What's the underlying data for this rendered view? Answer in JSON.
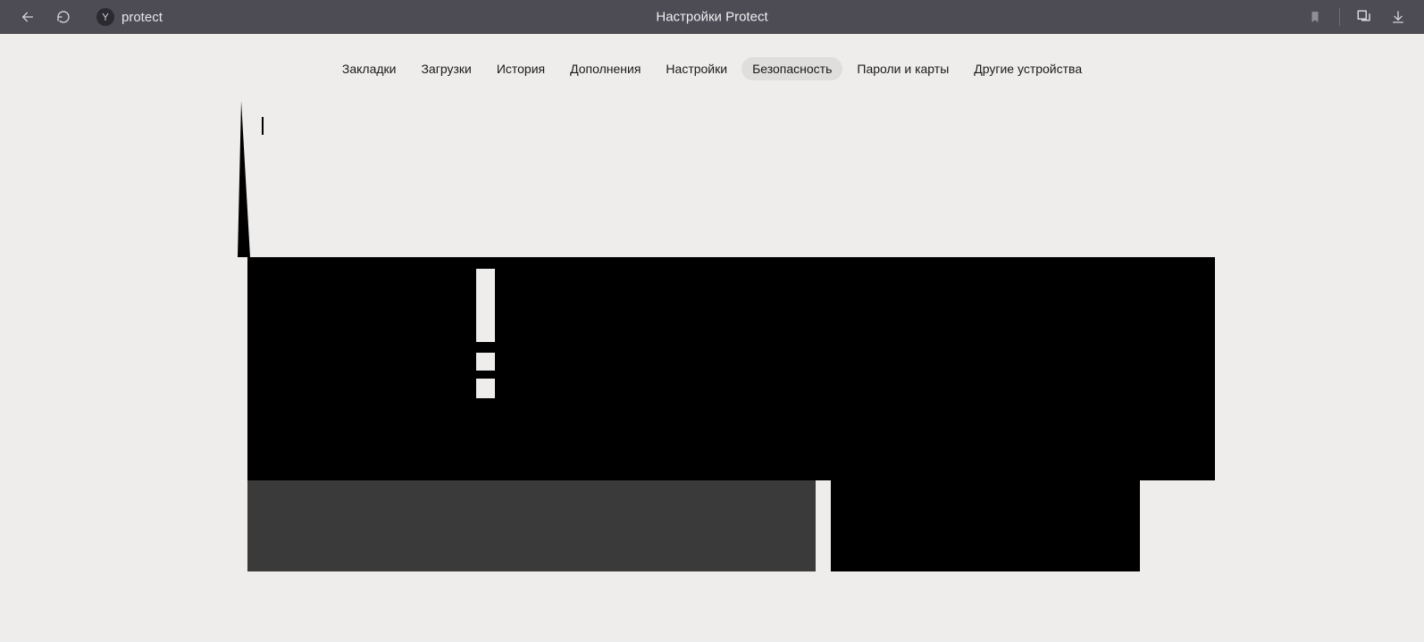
{
  "browser": {
    "address_text": "protect",
    "page_title": "Настройки Protect"
  },
  "tabs": {
    "items": [
      {
        "label": "Закладки",
        "active": false
      },
      {
        "label": "Загрузки",
        "active": false
      },
      {
        "label": "История",
        "active": false
      },
      {
        "label": "Дополнения",
        "active": false
      },
      {
        "label": "Настройки",
        "active": false
      },
      {
        "label": "Безопасность",
        "active": true
      },
      {
        "label": "Пароли и карты",
        "active": false
      },
      {
        "label": "Другие устройства",
        "active": false
      }
    ]
  }
}
